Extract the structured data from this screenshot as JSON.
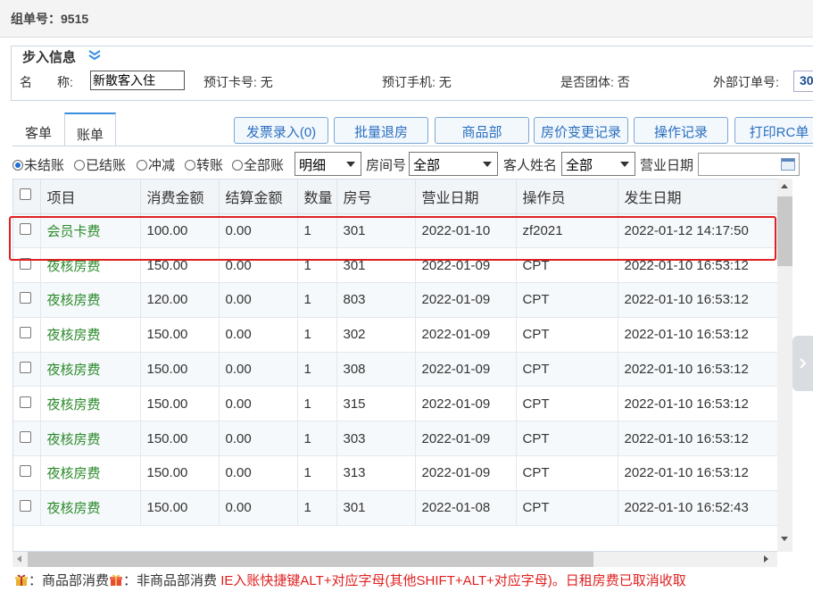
{
  "header": {
    "group_label": "组单号：",
    "group_value": "9515"
  },
  "step_info": {
    "title": "步入信息",
    "name_label": "名　　称:",
    "name_value": "新散客入住",
    "card_label": "预订卡号: 无",
    "phone_label": "预订手机: 无",
    "group_flag": "是否团体: 否",
    "ext_order_label": "外部订单号:",
    "ext_order_value": "30"
  },
  "tabs": [
    {
      "label": "客单",
      "active": false
    },
    {
      "label": "账单",
      "active": true
    }
  ],
  "toolbar": {
    "invoice": "发票录入(0)",
    "batch_checkout": "批量退房",
    "goods": "商品部",
    "price_log": "房价变更记录",
    "op_log": "操作记录",
    "print_rc": "打印RC单"
  },
  "filters": {
    "radios": [
      "未结账",
      "已结账",
      "冲减",
      "转账",
      "全部账"
    ],
    "selected_radio": "未结账",
    "detail_select": "明细",
    "room_label": "房间号",
    "room_select": "全部",
    "guest_label": "客人姓名",
    "guest_select": "全部",
    "date_label": "营业日期"
  },
  "table": {
    "columns": [
      "项目",
      "消费金额",
      "结算金额",
      "数量",
      "房号",
      "营业日期",
      "操作员",
      "发生日期"
    ],
    "rows": [
      [
        "会员卡费",
        "100.00",
        "0.00",
        "1",
        "301",
        "2022-01-10",
        "zf2021",
        "2022-01-12 14:17:50"
      ],
      [
        "夜核房费",
        "150.00",
        "0.00",
        "1",
        "301",
        "2022-01-09",
        "CPT",
        "2022-01-10 16:53:12"
      ],
      [
        "夜核房费",
        "120.00",
        "0.00",
        "1",
        "803",
        "2022-01-09",
        "CPT",
        "2022-01-10 16:53:12"
      ],
      [
        "夜核房费",
        "150.00",
        "0.00",
        "1",
        "302",
        "2022-01-09",
        "CPT",
        "2022-01-10 16:53:12"
      ],
      [
        "夜核房费",
        "150.00",
        "0.00",
        "1",
        "308",
        "2022-01-09",
        "CPT",
        "2022-01-10 16:53:12"
      ],
      [
        "夜核房费",
        "150.00",
        "0.00",
        "1",
        "315",
        "2022-01-09",
        "CPT",
        "2022-01-10 16:53:12"
      ],
      [
        "夜核房费",
        "150.00",
        "0.00",
        "1",
        "303",
        "2022-01-09",
        "CPT",
        "2022-01-10 16:53:12"
      ],
      [
        "夜核房费",
        "150.00",
        "0.00",
        "1",
        "313",
        "2022-01-09",
        "CPT",
        "2022-01-10 16:53:12"
      ],
      [
        "夜核房费",
        "150.00",
        "0.00",
        "1",
        "301",
        "2022-01-08",
        "CPT",
        "2022-01-10 16:52:43"
      ]
    ]
  },
  "footer": {
    "goods_legend": "：商品部消费",
    "non_goods_legend": "：非商品部消费",
    "hint": "IE入账快捷键ALT+对应字母(其他SHIFT+ALT+对应字母)。日租房费已取消收取"
  },
  "colors": {
    "accent": "#2a6fc0",
    "highlight": "#e02020",
    "item_text": "#2a8a2a"
  }
}
